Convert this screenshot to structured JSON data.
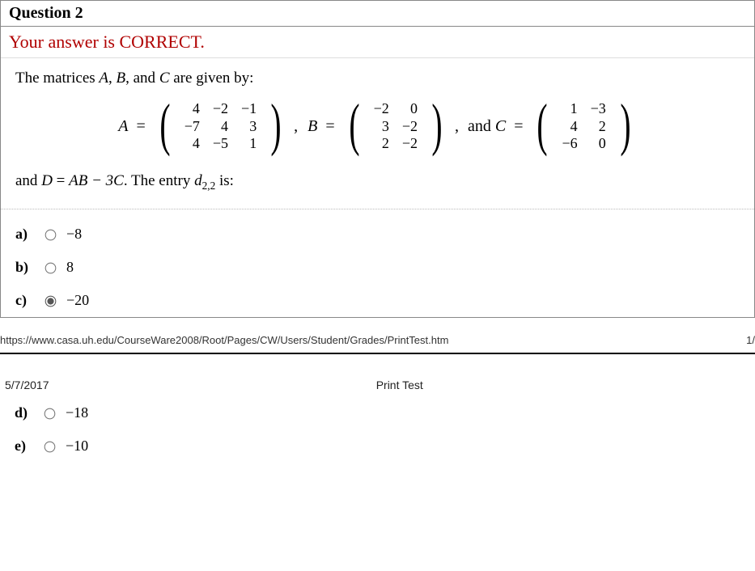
{
  "question": {
    "number_label": "Question 2",
    "feedback": "Your answer is CORRECT.",
    "stem_intro": "The matrices A, B, and C are given by:",
    "matrix_A_label": "A",
    "matrix_B_label": "B",
    "matrix_C_label": "C",
    "and_text": ", and ",
    "matrix_A": [
      [
        "4",
        "−2",
        "−1"
      ],
      [
        "−7",
        "4",
        "3"
      ],
      [
        "4",
        "−5",
        "1"
      ]
    ],
    "matrix_B": [
      [
        "−2",
        "0"
      ],
      [
        "3",
        "−2"
      ],
      [
        "2",
        "−2"
      ]
    ],
    "matrix_C": [
      [
        "1",
        "−3"
      ],
      [
        "4",
        "2"
      ],
      [
        "−6",
        "0"
      ]
    ],
    "stem_d_prefix": "and ",
    "stem_d_expr_lhs": "D",
    "stem_d_expr_rhs": "AB − 3C",
    "stem_d_suffix1": ". The entry ",
    "stem_d_entry": "d",
    "stem_d_sub": "2,2",
    "stem_d_suffix2": " is:"
  },
  "choices": [
    {
      "label": "a)",
      "value": "−8",
      "selected": false
    },
    {
      "label": "b)",
      "value": "8",
      "selected": false
    },
    {
      "label": "c)",
      "value": "−20",
      "selected": true
    },
    {
      "label": "d)",
      "value": "−18",
      "selected": false
    },
    {
      "label": "e)",
      "value": "−10",
      "selected": false
    }
  ],
  "footer": {
    "url": "https://www.casa.uh.edu/CourseWare2008/Root/Pages/CW/Users/Student/Grades/PrintTest.htm",
    "page_frag": "1/"
  },
  "page2": {
    "date": "5/7/2017",
    "title": "Print Test"
  }
}
